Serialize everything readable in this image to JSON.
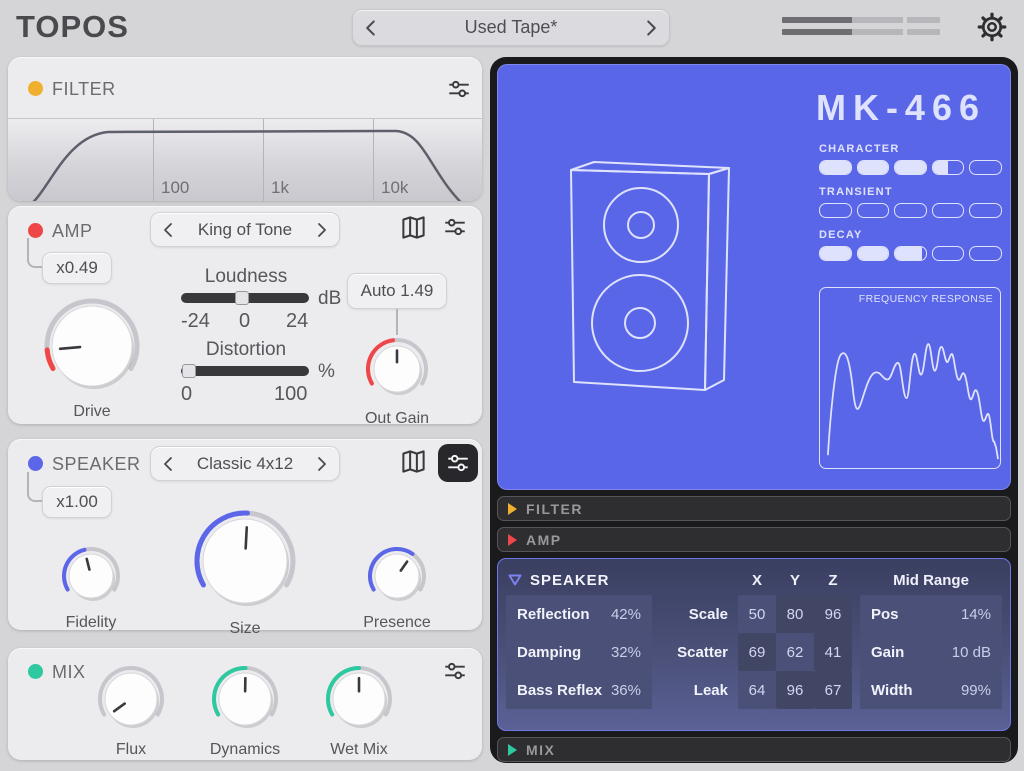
{
  "colors": {
    "accent_red": "#ef4747",
    "accent_blue": "#5b67e8",
    "accent_green": "#2ec9a0",
    "accent_yellow": "#eeb02e",
    "screen_bg": "#5a66e8",
    "screen_fg": "#dfe2fc"
  },
  "header": {
    "app_title": "TOPOS",
    "preset_value": "Used Tape*"
  },
  "filter_card": {
    "title": "FILTER",
    "freq_ticks": [
      "100",
      "1k",
      "10k"
    ]
  },
  "amp_card": {
    "title": "AMP",
    "multiplier": "x0.49",
    "preset": "King of Tone",
    "loudness_label": "Loudness",
    "loudness_unit": "dB",
    "loudness_ticks": [
      "-24",
      "0",
      "24"
    ],
    "distortion_label": "Distortion",
    "distortion_unit": "%",
    "distortion_ticks": [
      "0",
      "100"
    ],
    "auto_value": "Auto 1.49",
    "drive_label": "Drive",
    "out_gain_label": "Out Gain"
  },
  "speaker_card": {
    "title": "SPEAKER",
    "multiplier": "x1.00",
    "preset": "Classic 4x12",
    "knob_labels": [
      "Fidelity",
      "Size",
      "Presence"
    ]
  },
  "mix_card": {
    "title": "MIX",
    "knob_labels": [
      "Flux",
      "Dynamics",
      "Wet Mix"
    ]
  },
  "screen": {
    "model": "MK-466",
    "meters": [
      {
        "label": "CHARACTER",
        "fills": [
          1,
          1,
          1,
          0.5,
          0
        ]
      },
      {
        "label": "TRANSIENT",
        "fills": [
          0,
          0,
          0,
          0,
          0
        ]
      },
      {
        "label": "DECAY",
        "fills": [
          1,
          1,
          0.9,
          0,
          0
        ]
      }
    ],
    "fr_label": "FREQUENCY RESPONSE"
  },
  "accordion": {
    "filter_label": "FILTER",
    "amp_label": "AMP",
    "mix_label": "MIX",
    "speaker": {
      "title": "SPEAKER",
      "col_headers": [
        "X",
        "Y",
        "Z"
      ],
      "mid_header": "Mid Range",
      "left_rows": [
        {
          "label": "Reflection",
          "value": "42%"
        },
        {
          "label": "Damping",
          "value": "32%"
        },
        {
          "label": "Bass Reflex",
          "value": "36%"
        }
      ],
      "xyz_rows": [
        {
          "label": "Scale",
          "values": [
            "50",
            "80",
            "96"
          ]
        },
        {
          "label": "Scatter",
          "values": [
            "69",
            "62",
            "41"
          ]
        },
        {
          "label": "Leak",
          "values": [
            "64",
            "96",
            "67"
          ]
        }
      ],
      "mid_rows": [
        {
          "label": "Pos",
          "value": "14%"
        },
        {
          "label": "Gain",
          "value": "10 dB"
        },
        {
          "label": "Width",
          "value": "99%"
        }
      ]
    }
  }
}
